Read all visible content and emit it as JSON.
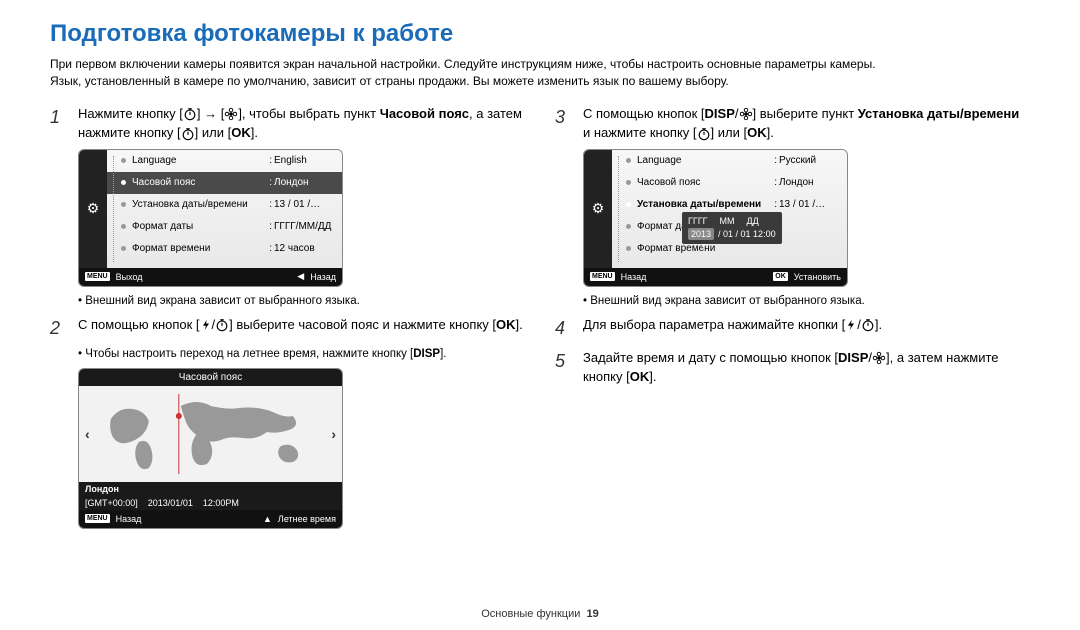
{
  "title": "Подготовка фотокамеры к работе",
  "intro_line1": "При первом включении камеры появится экран начальной настройки. Следуйте инструкциям ниже, чтобы настроить основные параметры камеры.",
  "intro_line2": "Язык, установленный в камере по умолчанию, зависит от страны продажи. Вы можете изменить язык по вашему выбору.",
  "steps": {
    "s1": {
      "num": "1",
      "p1": "Нажмите кнопку [",
      "p2": "] → [",
      "p3": "], чтобы выбрать пункт ",
      "bold1": "Часовой пояс",
      "p4": ", а затем нажмите кнопку [",
      "p5": "] или [",
      "p6": "]."
    },
    "s2": {
      "num": "2",
      "p1": "С помощью кнопок [",
      "p2": "/",
      "p3": "] выберите часовой пояс и нажмите кнопку [",
      "p4": "]."
    },
    "s2note": "Чтобы настроить переход на летнее время, нажмите кнопку [",
    "s2note_end": "].",
    "s3": {
      "num": "3",
      "p1": "С помощью кнопок [",
      "p2": "/",
      "p3": "] выберите пункт ",
      "bold1": "Установка даты/времени",
      "p4": " и нажмите кнопку [",
      "p5": "] или [",
      "p6": "]."
    },
    "s4": {
      "num": "4",
      "p1": "Для выбора параметра нажимайте кнопки [",
      "p2": "/",
      "p3": "]."
    },
    "s5": {
      "num": "5",
      "p1": "Задайте время и дату с помощью кнопок [",
      "p2": "/",
      "p3": "], а затем нажмите кнопку [",
      "p4": "]."
    }
  },
  "note1": "Внешний вид экрана зависит от выбранного языка.",
  "note3": "Внешний вид экрана зависит от выбранного языка.",
  "screen1": {
    "rows": [
      {
        "lab": "Language",
        "val": "English"
      },
      {
        "lab": "Часовой пояс",
        "val": "Лондон"
      },
      {
        "lab": "Установка даты/времени",
        "val": "13 / 01 /…"
      },
      {
        "lab": "Формат даты",
        "val": "ГГГГ/ММ/ДД"
      },
      {
        "lab": "Формат времени",
        "val": "12 часов"
      }
    ],
    "foot_left": "Выход",
    "foot_right": "Назад",
    "menu": "MENU"
  },
  "screen3": {
    "rows": [
      {
        "lab": "Language",
        "val": "Русский"
      },
      {
        "lab": "Часовой пояс",
        "val": "Лондон"
      },
      {
        "lab": "Установка даты/времени",
        "val": "13 / 01 /…"
      },
      {
        "lab": "Формат даты",
        "val": ""
      },
      {
        "lab": "Формат времени",
        "val": ""
      }
    ],
    "date_header": {
      "y": "ГГГГ",
      "m": "ММ",
      "d": "ДД"
    },
    "date_vals": "2013 / 01 / 01 12:00",
    "date_year": "2013",
    "foot_left": "Назад",
    "foot_right": "Установить",
    "menu": "MENU",
    "ok": "OK"
  },
  "tz": {
    "title": "Часовой пояс",
    "city": "Лондон",
    "gmt": "[GMT+00:00]",
    "date": "2013/01/01",
    "time": "12:00PM",
    "foot_left": "Назад",
    "foot_right": "Летнее время",
    "menu": "MENU"
  },
  "icons": {
    "disp": "DISP",
    "ok": "OK",
    "flower": "❀"
  },
  "footer": {
    "label": "Основные функции",
    "page": "19"
  }
}
